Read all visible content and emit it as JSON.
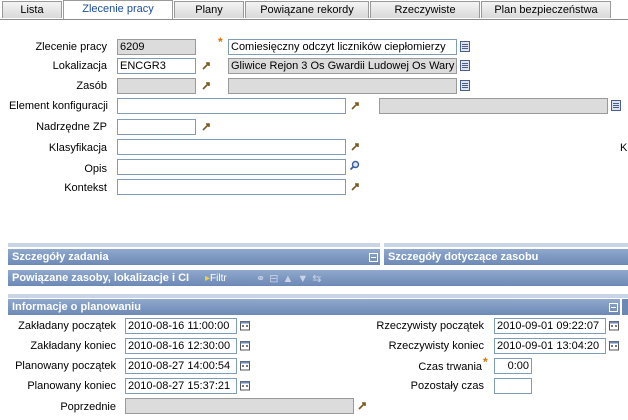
{
  "tabs": [
    {
      "label": "Lista"
    },
    {
      "label": "Zlecenie pracy"
    },
    {
      "label": "Plany"
    },
    {
      "label": "Powiązane rekordy"
    },
    {
      "label": "Rzeczywiste"
    },
    {
      "label": "Plan bezpieczeństwa"
    }
  ],
  "form": {
    "work_order_label": "Zlecenie pracy",
    "work_order_value": "6209",
    "description_value": "Comiesięczny odczyt liczników ciepłomierzy",
    "location_label": "Lokalizacja",
    "location_value": "ENCGR3",
    "location_desc": "Gliwice Rejon 3 Os Gwardii Ludowej Os Wary",
    "asset_label": "Zasób",
    "asset_value": "",
    "asset_desc": "",
    "ci_label": "Element konfiguracji",
    "ci_value": "",
    "ci_desc": "",
    "parent_label": "Nadrzędne ZP",
    "parent_value": "",
    "classification_label": "Klasyfikacja",
    "classification_value": "",
    "classification_extra": "K",
    "desc_label": "Opis",
    "desc_value": "",
    "context_label": "Kontekst",
    "context_value": ""
  },
  "sections": {
    "task_details": "Szczegóły zadania",
    "asset_details": "Szczegóły dotyczące zasobu",
    "related": "Powiązane zasoby, lokalizacje i CI",
    "filter_label": "Filtr",
    "planning": "Informacje o planowaniu"
  },
  "planning": {
    "target_start_label": "Zakładany początek",
    "target_start_value": "2010-08-16 11:00:00",
    "target_finish_label": "Zakładany koniec",
    "target_finish_value": "2010-08-16 12:30:00",
    "sched_start_label": "Planowany początek",
    "sched_start_value": "2010-08-27 14:00:54",
    "sched_finish_label": "Planowany koniec",
    "sched_finish_value": "2010-08-27 15:37:21",
    "previous_label": "Poprzednie",
    "previous_value": "",
    "actual_start_label": "Rzeczywisty początek",
    "actual_start_value": "2010-09-01 09:22:07",
    "actual_finish_label": "Rzeczywisty koniec",
    "actual_finish_value": "2010-09-01 13:04:20",
    "duration_label": "Czas trwania",
    "duration_value": "0:00",
    "remaining_label": "Pozostały czas",
    "remaining_value": ""
  },
  "colors": {
    "section_bg": "#7a94bf",
    "required": "#e07000",
    "readonly_bg": "#dcdcdc"
  }
}
